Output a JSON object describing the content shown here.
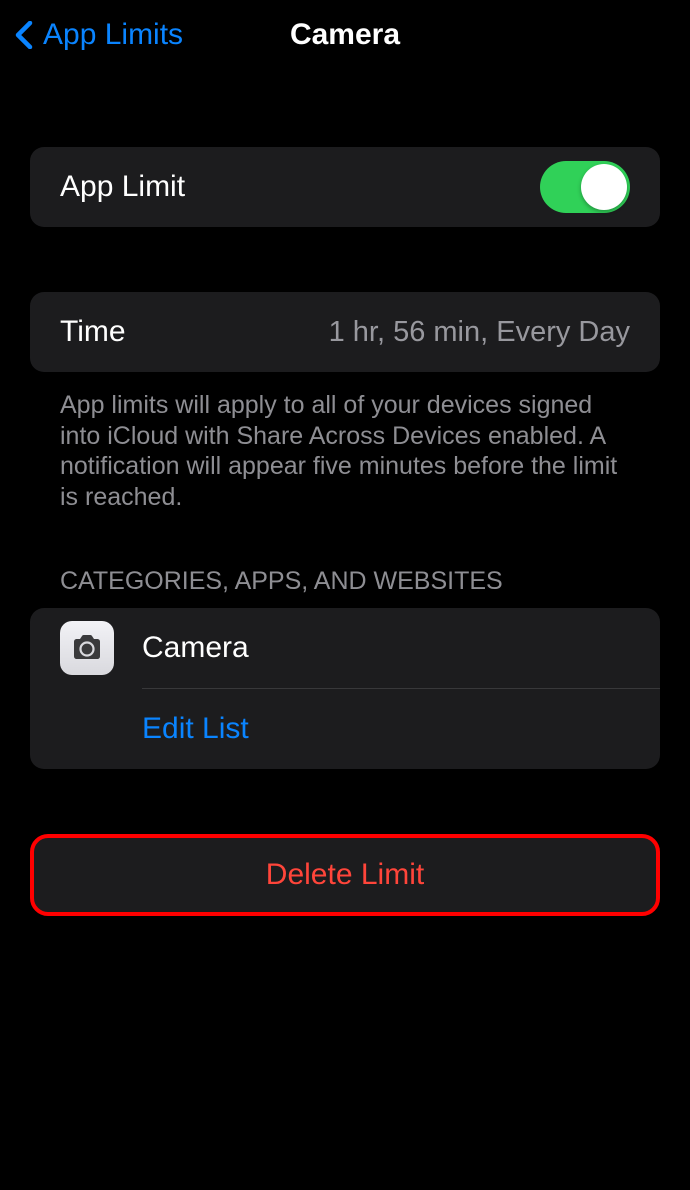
{
  "nav": {
    "back_label": "App Limits",
    "title": "Camera"
  },
  "app_limit": {
    "label": "App Limit",
    "enabled": true
  },
  "time": {
    "label": "Time",
    "value": "1 hr, 56 min, Every Day"
  },
  "description": "App limits will apply to all of your devices signed into iCloud with Share Across Devices enabled. A notification will appear five minutes before the limit is reached.",
  "categories_header": "CATEGORIES, APPS, AND WEBSITES",
  "apps": {
    "item_name": "Camera",
    "edit_label": "Edit List"
  },
  "delete_label": "Delete Limit"
}
